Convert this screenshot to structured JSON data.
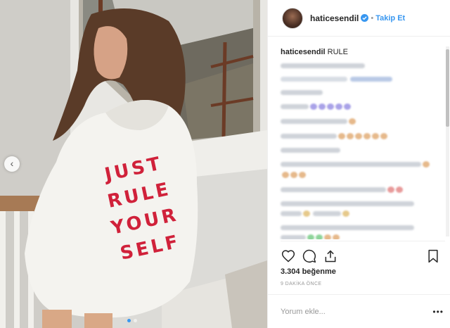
{
  "post": {
    "username": "haticesendil",
    "follow_label": "Takip Et",
    "bullet": "•",
    "caption_user": "haticesendil",
    "caption_text": "RULE",
    "hoodie_text": [
      "JUST",
      "RULE",
      "YOUR",
      "SELF"
    ],
    "likes": "3.304 beğenme",
    "time_ago": "9 DAKİKA ÖNCE",
    "comment_placeholder": "Yorum ekle...",
    "more_label": "•••",
    "prev_arrow": "‹",
    "slide_count": 2,
    "active_slide": 1
  },
  "icons": {
    "verified": "verified-badge-icon",
    "like": "heart-icon",
    "comment": "comment-bubble-icon",
    "share": "share-icon",
    "save": "bookmark-icon",
    "prev": "chevron-left-icon"
  },
  "colors": {
    "accent": "#3897f0",
    "text": "#262626",
    "muted": "#999999",
    "hoodie_text": "#d0213a"
  }
}
